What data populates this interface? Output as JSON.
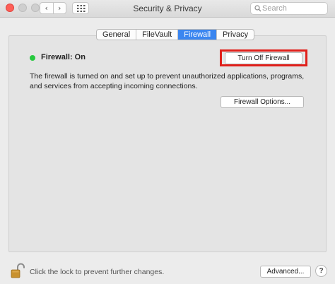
{
  "window": {
    "title": "Security & Privacy",
    "back_glyph": "‹",
    "forward_glyph": "›",
    "search_placeholder": "Search"
  },
  "tabs": [
    {
      "label": "General"
    },
    {
      "label": "FileVault"
    },
    {
      "label": "Firewall"
    },
    {
      "label": "Privacy"
    }
  ],
  "active_tab": "Firewall",
  "firewall": {
    "status_label": "Firewall: On",
    "status_color": "#27c93f",
    "toggle_button": "Turn Off Firewall",
    "highlight_color": "#e0201b",
    "description": "The firewall is turned on and set up to prevent unauthorized applications, programs, and services from accepting incoming connections.",
    "options_button": "Firewall Options..."
  },
  "footer": {
    "lock_text": "Click the lock to prevent further changes.",
    "advanced_button": "Advanced...",
    "help_glyph": "?"
  },
  "icons": {
    "close": "close-icon",
    "minimize": "minimize-icon",
    "zoom": "zoom-icon",
    "back": "chevron-left-icon",
    "forward": "chevron-right-icon",
    "show_all": "grid-icon",
    "search": "search-icon",
    "status": "status-dot-icon",
    "lock": "unlocked-padlock-icon",
    "help": "help-icon"
  },
  "colors": {
    "accent": "#3b86f0",
    "close_button": "#fe5f57"
  }
}
